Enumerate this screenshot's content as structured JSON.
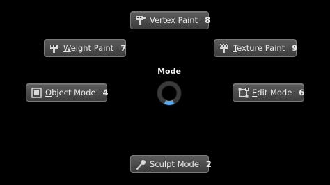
{
  "pie_menu": {
    "title": "Mode",
    "items": [
      {
        "id": "vertex",
        "label_prefix": "",
        "label_underline": "V",
        "label_rest": "ertex Paint",
        "shortcut": "8",
        "icon": "vertex-paint-icon"
      },
      {
        "id": "weight",
        "label_prefix": "",
        "label_underline": "W",
        "label_rest": "eight Paint",
        "shortcut": "7",
        "icon": "weight-paint-icon"
      },
      {
        "id": "texture",
        "label_prefix": "",
        "label_underline": "T",
        "label_rest": "exture Paint",
        "shortcut": "9",
        "icon": "texture-paint-icon"
      },
      {
        "id": "object",
        "label_prefix": "",
        "label_underline": "O",
        "label_rest": "bject Mode",
        "shortcut": "4",
        "icon": "object-mode-icon"
      },
      {
        "id": "edit",
        "label_prefix": "",
        "label_underline": "E",
        "label_rest": "dit Mode",
        "shortcut": "6",
        "icon": "edit-mode-icon"
      },
      {
        "id": "sculpt",
        "label_prefix": "",
        "label_underline": "S",
        "label_rest": "culpt Mode",
        "shortcut": "2",
        "icon": "sculpt-mode-icon"
      }
    ],
    "colors": {
      "accent": "#5aa9e6",
      "ring": "#2e2e2e",
      "button_border": "#7a7a7a"
    }
  }
}
